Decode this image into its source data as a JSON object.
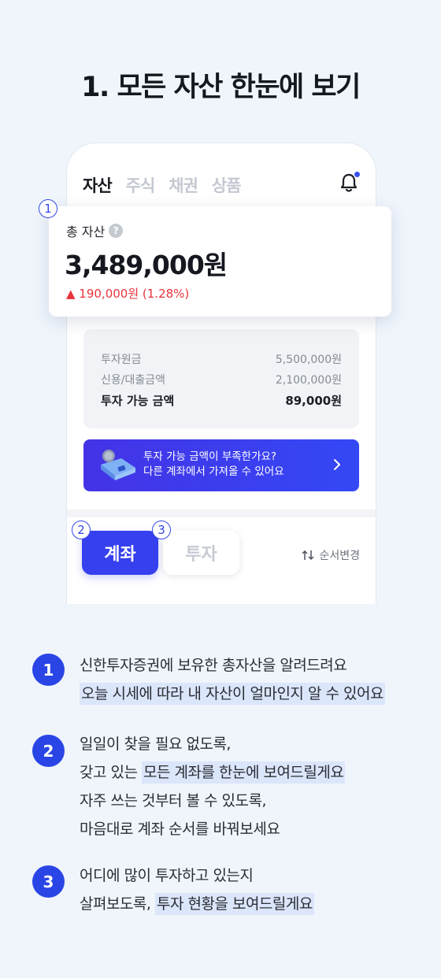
{
  "headline": "1. 모든 자산 한눈에 보기",
  "app": {
    "tabs": [
      "자산",
      "주식",
      "채권",
      "상품"
    ],
    "total_label": "총 자산",
    "total_amount": "3,489,000원",
    "total_change": "▲ 190,000원 (1.28%)",
    "summary_rows": [
      {
        "label": "투자원금",
        "value": "5,500,000원"
      },
      {
        "label": "신용/대출금액",
        "value": "2,100,000원"
      },
      {
        "label": "투자 가능 금액",
        "value": "89,000원"
      }
    ],
    "banner_line1": "투자 가능 금액이 부족한가요?",
    "banner_line2": "다른 계좌에서 가져올 수 있어요",
    "btn_account": "계좌",
    "btn_invest": "투자",
    "sort_label": "순서변경",
    "badges": [
      "1",
      "2",
      "3"
    ]
  },
  "descriptions": [
    {
      "num": "1",
      "lines": [
        {
          "parts": [
            {
              "t": "신한투자증권에 보유한 총자산을 알려드려요",
              "hl": false
            }
          ]
        },
        {
          "parts": [
            {
              "t": "오늘 시세에 따라 내 자산이 얼마인지 알 수 있어요",
              "hl": true
            }
          ]
        }
      ]
    },
    {
      "num": "2",
      "lines": [
        {
          "parts": [
            {
              "t": "일일이 찾을 필요 없도록,",
              "hl": false
            }
          ]
        },
        {
          "parts": [
            {
              "t": "갖고 있는 ",
              "hl": false
            },
            {
              "t": "모든 계좌를 한눈에 보여드릴게요",
              "hl": true
            }
          ]
        },
        {
          "parts": [
            {
              "t": "자주 쓰는 것부터 볼 수 있도록,",
              "hl": false
            }
          ]
        },
        {
          "parts": [
            {
              "t": "마음대로 계좌 순서를 바꿔보세요",
              "hl": false
            }
          ]
        }
      ]
    },
    {
      "num": "3",
      "lines": [
        {
          "parts": [
            {
              "t": "어디에 많이 투자하고 있는지",
              "hl": false
            }
          ]
        },
        {
          "parts": [
            {
              "t": "살펴보도록, ",
              "hl": false
            },
            {
              "t": "투자 현황을 보여드릴게요",
              "hl": true
            }
          ]
        }
      ]
    }
  ]
}
